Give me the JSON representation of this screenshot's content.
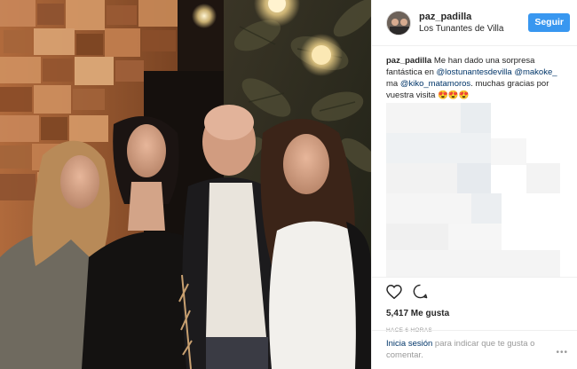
{
  "post": {
    "username": "paz_padilla",
    "location": "Los Tunantes de Villa",
    "follow_label": "Seguir"
  },
  "caption": {
    "user": "paz_padilla",
    "text1": "Me han dado una sorpresa fantástica en",
    "mention1": "@lostunantesdevilla",
    "mention2": "@makoke_",
    "text2": "ma",
    "mention3": "@kiko_matamoros",
    "text3": ". muchas gracias por vuestra visita",
    "emoji": "😍😍😍"
  },
  "actions": {
    "like_icon": "heart-icon",
    "comment_icon": "comment-icon",
    "likes": "5,417 Me gusta",
    "time": "HACE 6 HORAS"
  },
  "login": {
    "link": "Inicia sesión",
    "text": "para indicar que te gusta o comentar.",
    "more": "•••"
  },
  "colors": {
    "accent": "#3897f0",
    "mention": "#003569",
    "muted": "#999999",
    "border": "#efefef"
  }
}
